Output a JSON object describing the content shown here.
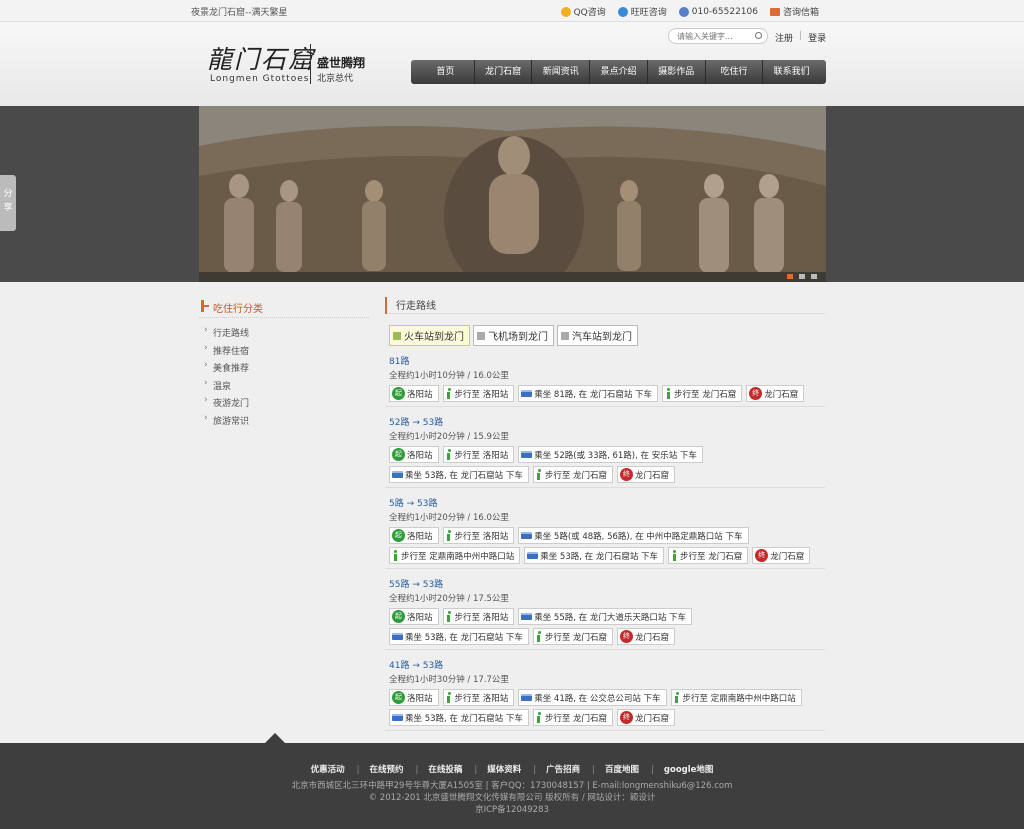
{
  "topbar": {
    "slogan": "夜景龙门石窟--满天繁星",
    "qq": "QQ咨询",
    "wangwang": "旺旺咨询",
    "phone": "010-65522106",
    "mail": "咨询信箱"
  },
  "header": {
    "logo_cn": "龍门石窟",
    "logo_en": "Longmen Gtottoes",
    "brand": "盛世腾翔",
    "brand_sub": "北京总代",
    "search_placeholder": "请输入关键字...",
    "register": "注册",
    "login": "登录",
    "nav": [
      "首页",
      "龙门石窟",
      "新闻资讯",
      "景点介绍",
      "摄影作品",
      "吃住行",
      "联系我们"
    ]
  },
  "share": [
    "分",
    "享"
  ],
  "sidebar": {
    "title": "吃住行分类",
    "items": [
      "行走路线",
      "推荐住宿",
      "美食推荐",
      "温泉",
      "夜游龙门",
      "旅游常识"
    ]
  },
  "main": {
    "title": "行走路线",
    "tabs": [
      "火车站到龙门",
      "飞机场到龙门",
      "汽车站到龙门"
    ],
    "routes": [
      {
        "name": "81路",
        "info": "全程约1小时10分钟 / 16.0公里",
        "steps": [
          {
            "type": "start",
            "text": "洛阳站"
          },
          {
            "type": "walk",
            "text": "步行至 洛阳站"
          },
          {
            "type": "bus",
            "text": "乘坐 81路, 在 龙门石窟站 下车"
          },
          {
            "type": "walk",
            "text": "步行至 龙门石窟"
          },
          {
            "type": "end",
            "text": "龙门石窟"
          }
        ]
      },
      {
        "name": "52路 → 53路",
        "info": "全程约1小时20分钟 / 15.9公里",
        "steps": [
          {
            "type": "start",
            "text": "洛阳站"
          },
          {
            "type": "walk",
            "text": "步行至 洛阳站"
          },
          {
            "type": "bus",
            "text": "乘坐 52路(或 33路, 61路), 在 安乐站 下车"
          },
          {
            "type": "bus",
            "text": "乘坐 53路, 在 龙门石窟站 下车"
          },
          {
            "type": "walk",
            "text": "步行至 龙门石窟"
          },
          {
            "type": "end",
            "text": "龙门石窟"
          }
        ]
      },
      {
        "name": "5路 → 53路",
        "info": "全程约1小时20分钟 / 16.0公里",
        "steps": [
          {
            "type": "start",
            "text": "洛阳站"
          },
          {
            "type": "walk",
            "text": "步行至 洛阳站"
          },
          {
            "type": "bus",
            "text": "乘坐 5路(或 48路, 56路), 在 中州中路定鼎路口站 下车"
          },
          {
            "type": "walk",
            "text": "步行至 定鼎南路中州中路口站"
          },
          {
            "type": "bus",
            "text": "乘坐 53路, 在 龙门石窟站 下车"
          },
          {
            "type": "walk",
            "text": "步行至 龙门石窟"
          },
          {
            "type": "end",
            "text": "龙门石窟"
          }
        ]
      },
      {
        "name": "55路 → 53路",
        "info": "全程约1小时20分钟 / 17.5公里",
        "steps": [
          {
            "type": "start",
            "text": "洛阳站"
          },
          {
            "type": "walk",
            "text": "步行至 洛阳站"
          },
          {
            "type": "bus",
            "text": "乘坐 55路, 在 龙门大道乐天路口站 下车"
          },
          {
            "type": "bus",
            "text": "乘坐 53路, 在 龙门石窟站 下车"
          },
          {
            "type": "walk",
            "text": "步行至 龙门石窟"
          },
          {
            "type": "end",
            "text": "龙门石窟"
          }
        ]
      },
      {
        "name": "41路 → 53路",
        "info": "全程约1小时30分钟 / 17.7公里",
        "steps": [
          {
            "type": "start",
            "text": "洛阳站"
          },
          {
            "type": "walk",
            "text": "步行至 洛阳站"
          },
          {
            "type": "bus",
            "text": "乘坐 41路, 在 公交总公司站 下车"
          },
          {
            "type": "walk",
            "text": "步行至 定鼎南路中州中路口站"
          },
          {
            "type": "bus",
            "text": "乘坐 53路, 在 龙门石窟站 下车"
          },
          {
            "type": "walk",
            "text": "步行至 龙门石窟"
          },
          {
            "type": "end",
            "text": "龙门石窟"
          }
        ]
      }
    ]
  },
  "footer": {
    "links": [
      "优惠活动",
      "在线预约",
      "在线投稿",
      "媒体资料",
      "广告招商",
      "百度地图",
      "google地图"
    ],
    "address": "北京市西城区北三环中路甲29号华尊大厦A1505室 | 客户QQ：1730048157 | E-mail:longmenshiku6@126.com",
    "copyright": "© 2012-201 北京盛世腾翔文化传媒有限公司 版权所有 / 网站设计：颖设计",
    "icp": "京ICP备12049283"
  }
}
